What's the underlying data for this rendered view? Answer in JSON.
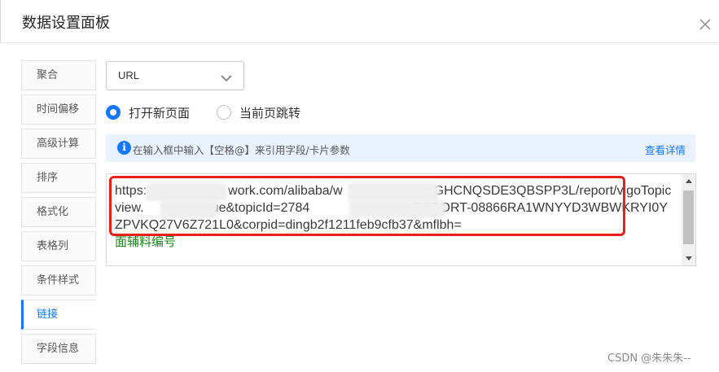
{
  "dialog": {
    "title": "数据设置面板"
  },
  "sidebar": {
    "items": [
      {
        "label": "聚合"
      },
      {
        "label": "时间偏移"
      },
      {
        "label": "高级计算"
      },
      {
        "label": "排序"
      },
      {
        "label": "格式化"
      },
      {
        "label": "表格列"
      },
      {
        "label": "条件样式"
      },
      {
        "label": "链接"
      },
      {
        "label": "字段信息"
      }
    ],
    "active_index": 7
  },
  "link_type_select": {
    "value": "URL"
  },
  "open_mode": {
    "options": [
      {
        "label": "打开新页面",
        "checked": true
      },
      {
        "label": "当前页跳转",
        "checked": false
      }
    ]
  },
  "info": {
    "text": "在输入框中输入【空格@】来引用字段/卡片参数",
    "link": "查看详情"
  },
  "editor": {
    "url_parts": [
      "https:",
      "work.com/alibaba/w",
      "GHCNQSDE3QBSPP3L/report/vigoTopicview.",
      "=true&topicId=2784",
      "=REPORT-08866RA1WNYYD3WBWKRYI0YZPVKQ27V6Z721L0&corpid=dingb2f1211feb9cfb37&mflbh="
    ],
    "field_ref": "面辅料编号"
  },
  "watermark": "CSDN @朱朱朱--",
  "colors": {
    "accent": "#1677ff",
    "highlight_border": "#e8201a",
    "info_background": "#e8f3ff",
    "field_text": "#1a8a1a"
  }
}
